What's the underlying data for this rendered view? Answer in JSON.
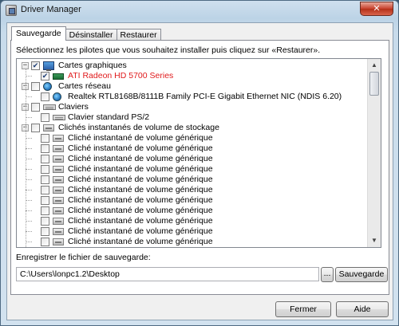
{
  "window": {
    "title": "Driver Manager",
    "close_glyph": "✕"
  },
  "tabs": [
    {
      "label": "Sauvegarde",
      "active": true
    },
    {
      "label": "Désinstaller",
      "active": false
    },
    {
      "label": "Restaurer",
      "active": false
    }
  ],
  "instructions": "Sélectionnez les pilotes que vous souhaitez installer puis cliquez sur «Restaurer».",
  "tree": {
    "nodes": [
      {
        "label": "Cartes graphiques",
        "expanded": true,
        "checked": true,
        "icon": "display-icon"
      },
      {
        "label": "ATI Radeon HD 5700 Series",
        "checked": true,
        "icon": "display-card-icon",
        "highlight": true
      },
      {
        "label": "Cartes réseau",
        "expanded": true,
        "checked": false,
        "icon": "network-icon"
      },
      {
        "label": "Realtek RTL8168B/8111B Family PCI-E Gigabit Ethernet NIC (NDIS 6.20)",
        "checked": false,
        "icon": "network-icon"
      },
      {
        "label": "Claviers",
        "expanded": true,
        "checked": false,
        "icon": "keyboard-icon"
      },
      {
        "label": "Clavier standard PS/2",
        "checked": false,
        "icon": "keyboard-icon"
      },
      {
        "label": "Clichés instantanés de volume de stockage",
        "expanded": true,
        "checked": false,
        "icon": "drive-icon"
      },
      {
        "label": "Cliché instantané de volume générique",
        "checked": false,
        "icon": "drive-icon"
      },
      {
        "label": "Cliché instantané de volume générique",
        "checked": false,
        "icon": "drive-icon"
      },
      {
        "label": "Cliché instantané de volume générique",
        "checked": false,
        "icon": "drive-icon"
      },
      {
        "label": "Cliché instantané de volume générique",
        "checked": false,
        "icon": "drive-icon"
      },
      {
        "label": "Cliché instantané de volume générique",
        "checked": false,
        "icon": "drive-icon"
      },
      {
        "label": "Cliché instantané de volume générique",
        "checked": false,
        "icon": "drive-icon"
      },
      {
        "label": "Cliché instantané de volume générique",
        "checked": false,
        "icon": "drive-icon"
      },
      {
        "label": "Cliché instantané de volume générique",
        "checked": false,
        "icon": "drive-icon"
      },
      {
        "label": "Cliché instantané de volume générique",
        "checked": false,
        "icon": "drive-icon"
      },
      {
        "label": "Cliché instantané de volume générique",
        "checked": false,
        "icon": "drive-icon"
      },
      {
        "label": "Cliché instantané de volume générique",
        "checked": false,
        "icon": "drive-icon"
      },
      {
        "label": "Cliché instantané de volume générique",
        "checked": false,
        "icon": "drive-icon"
      },
      {
        "label": "Cliché instantané de volume générique",
        "checked": false,
        "icon": "drive-icon"
      }
    ]
  },
  "save": {
    "label": "Enregistrer le fichier de sauvegarde:",
    "path": "C:\\Users\\lonpc1.2\\Desktop",
    "browse_label": "...",
    "backup_label": "Sauvegarde"
  },
  "footer": {
    "close_label": "Fermer",
    "help_label": "Aide"
  },
  "colors": {
    "highlight": "#e0191b",
    "titlebar": "#bcd3e6",
    "close": "#c8412c"
  }
}
